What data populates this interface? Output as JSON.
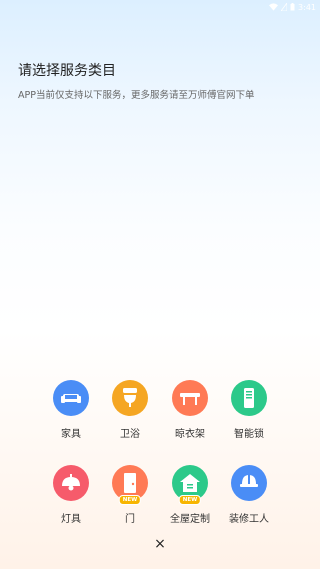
{
  "status_bar": {
    "time": "3:41"
  },
  "header": {
    "title": "请选择服务类目",
    "subtitle": "APP当前仅支持以下服务，更多服务请至万师傅官网下单"
  },
  "services": [
    {
      "label": "家具",
      "icon": "sofa-icon",
      "color": "#4a8df6"
    },
    {
      "label": "卫浴",
      "icon": "toilet-icon",
      "color": "#f5a623"
    },
    {
      "label": "晾衣架",
      "icon": "clothes-rack-icon",
      "color": "#ff7a55"
    },
    {
      "label": "智能锁",
      "icon": "smart-lock-icon",
      "color": "#2cc98a"
    },
    {
      "label": "灯具",
      "icon": "lamp-icon",
      "color": "#f65b6b"
    },
    {
      "label": "门",
      "icon": "door-icon",
      "color": "#ff7a55",
      "badge": "NEW"
    },
    {
      "label": "全屋定制",
      "icon": "house-icon",
      "color": "#2cc98a",
      "badge": "NEW"
    },
    {
      "label": "装修工人",
      "icon": "worker-icon",
      "color": "#4a8df6"
    }
  ],
  "close_label": "×"
}
